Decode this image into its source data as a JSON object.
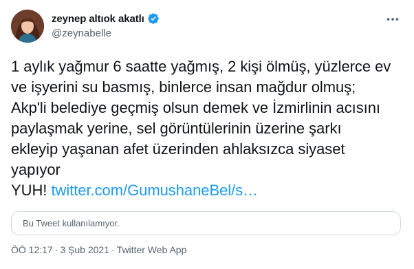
{
  "author": {
    "display_name": "zeynep altıok akatlı",
    "handle": "@zeynabelle",
    "avatar_icon": "user-avatar",
    "verified_icon": "verified-badge-icon"
  },
  "tweet": {
    "text_lines": [
      "1 aylık yağmur 6 saatte yağmış, 2 kişi ölmüş, yüzlerce ev",
      "ve işyerini su basmış, binlerce insan mağdur olmuş;",
      "Akp'li belediye geçmiş olsun demek ve İzmirlinin acısını",
      "paylaşmak yerine, sel görüntülerinin üzerine şarkı",
      "ekleyip yaşanan afet üzerinden ahlaksızca siyaset",
      "yapıyor"
    ],
    "yuh": "YUH!",
    "link": "twitter.com/GumushaneBel/s…"
  },
  "withheld": {
    "text": "Bu Tweet kullanılamıyor."
  },
  "meta": {
    "time": "ÖÖ 12:17",
    "separator": "·",
    "date": "3 Şub 2021",
    "source": "Twitter Web App"
  },
  "colors": {
    "text": "#0f1419",
    "secondary": "#536471",
    "link": "#1d9bf0",
    "border": "#cfd9de"
  }
}
